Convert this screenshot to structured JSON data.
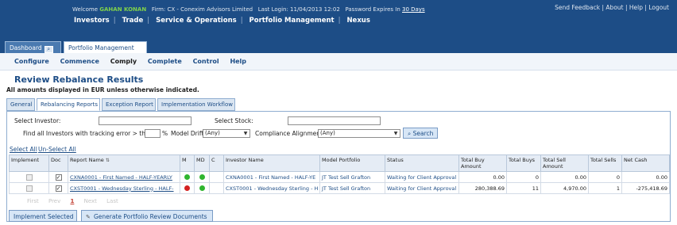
{
  "header": {
    "welcome_prefix": "Welcome",
    "user_name": "GAHAN KONAN",
    "firm": "Firm: CX - Conexim Advisors Limited",
    "last_login": "Last Login: 11/04/2013 12:02",
    "password_prefix": "Password Expires In",
    "password_days": "30 Days",
    "links": [
      "Send Feedback",
      "About",
      "Help",
      "Logout"
    ],
    "nav": [
      "Investors",
      "Trade",
      "Service & Operations",
      "Portfolio Management",
      "Nexus"
    ]
  },
  "page_tabs": {
    "dashboard": "Dashboard",
    "portfolio": "Portfolio Management"
  },
  "subnav": [
    "Configure",
    "Commence",
    "Comply",
    "Complete",
    "Control",
    "Help"
  ],
  "page": {
    "title": "Review Rebalance Results",
    "note": "All amounts displayed in EUR unless otherwise indicated."
  },
  "content_tabs": [
    "General",
    "Rebalancing Reports",
    "Exception Report",
    "Implementation Workflow"
  ],
  "filters": {
    "select_investor_label": "Select Investor:",
    "select_stock_label": "Select Stock:",
    "tracking_label": "Find all Investors with tracking error > than",
    "percent": "%",
    "model_drift_label": "Model Drift",
    "model_drift_value": "(Any)",
    "compliance_label": "Compliance Alignment",
    "compliance_value": "(Any)",
    "search_label": "Search"
  },
  "selection": {
    "select_all": "Select All",
    "unselect_all": "Un-Select All"
  },
  "table": {
    "headers": [
      "Implement",
      "Doc",
      "Report Name",
      "M",
      "MD",
      "C",
      "Investor Name",
      "Model Portfolio",
      "Status",
      "Total Buy Amount",
      "Total Buys",
      "Total Sell Amount",
      "Total Sells",
      "Net Cash"
    ],
    "rows": [
      {
        "report": "CXNA0001 - First Named - HALF-YEARLY",
        "m": "#2fb52f",
        "md": "#2fb52f",
        "investor": "CXNA0001 - First Named - HALF-YE",
        "model": "JT Test Sell Grafton",
        "status": "Waiting for Client Approval",
        "buy_amount": "0.00",
        "buys": "0",
        "sell_amount": "0.00",
        "sells": "0",
        "net_cash": "0.00"
      },
      {
        "report": "CXST0001 - Wednesday Sterling - HALF-",
        "m": "#d42121",
        "md": "#2fb52f",
        "investor": "CXST0001 - Wednesday Sterling - H",
        "model": "JT Test Sell Grafton",
        "status": "Waiting for Client Approval",
        "buy_amount": "280,388.69",
        "buys": "11",
        "sell_amount": "4,970.00",
        "sells": "1",
        "net_cash": "-275,418.69"
      }
    ]
  },
  "pager": {
    "first": "First",
    "prev": "Prev",
    "page": "1",
    "next": "Next",
    "last": "Last"
  },
  "buttons": {
    "implement": "Implement Selected",
    "generate": "Generate Portfolio Review Documents"
  }
}
